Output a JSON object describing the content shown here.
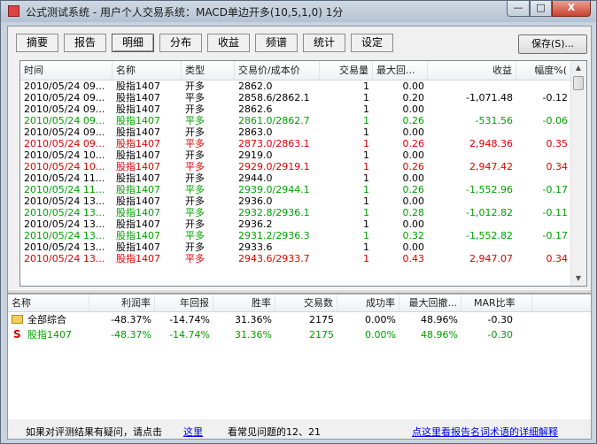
{
  "window": {
    "title": "公式测试系统 - 用户个人交易系统：MACD单边开多(10,5,1,0) 1分",
    "min_label": "—",
    "max_label": "□",
    "close_label": "X"
  },
  "tabs": [
    "摘要",
    "报告",
    "明细",
    "分布",
    "收益",
    "频谱",
    "统计",
    "设定"
  ],
  "active_tab": "明细",
  "save_button": "保存(S)...",
  "details_table": {
    "columns": [
      "时间",
      "名称",
      "类型",
      "交易价/成本价",
      "交易量",
      "最大回...",
      "收益",
      "幅度%("
    ],
    "rows": [
      {
        "time": "2010/05/24 09...",
        "name": "股指1407",
        "type": "开多",
        "price": "2862.0",
        "vol": "1",
        "dd": "0.00",
        "profit": "",
        "pct": "",
        "color": "black"
      },
      {
        "time": "2010/05/24 09...",
        "name": "股指1407",
        "type": "平多",
        "price": "2858.6/2862.1",
        "vol": "1",
        "dd": "0.20",
        "profit": "-1,071.48",
        "pct": "-0.12",
        "color": "black"
      },
      {
        "time": "2010/05/24 09...",
        "name": "股指1407",
        "type": "开多",
        "price": "2862.6",
        "vol": "1",
        "dd": "0.00",
        "profit": "",
        "pct": "",
        "color": "black"
      },
      {
        "time": "2010/05/24 09...",
        "name": "股指1407",
        "type": "平多",
        "price": "2861.0/2862.7",
        "vol": "1",
        "dd": "0.26",
        "profit": "-531.56",
        "pct": "-0.06",
        "color": "green"
      },
      {
        "time": "2010/05/24 09...",
        "name": "股指1407",
        "type": "开多",
        "price": "2863.0",
        "vol": "1",
        "dd": "0.00",
        "profit": "",
        "pct": "",
        "color": "black"
      },
      {
        "time": "2010/05/24 09...",
        "name": "股指1407",
        "type": "平多",
        "price": "2873.0/2863.1",
        "vol": "1",
        "dd": "0.26",
        "profit": "2,948.36",
        "pct": "0.35",
        "color": "red"
      },
      {
        "time": "2010/05/24 10...",
        "name": "股指1407",
        "type": "开多",
        "price": "2919.0",
        "vol": "1",
        "dd": "0.00",
        "profit": "",
        "pct": "",
        "color": "black"
      },
      {
        "time": "2010/05/24 10...",
        "name": "股指1407",
        "type": "平多",
        "price": "2929.0/2919.1",
        "vol": "1",
        "dd": "0.26",
        "profit": "2,947.42",
        "pct": "0.34",
        "color": "red"
      },
      {
        "time": "2010/05/24 11...",
        "name": "股指1407",
        "type": "开多",
        "price": "2944.0",
        "vol": "1",
        "dd": "0.00",
        "profit": "",
        "pct": "",
        "color": "black"
      },
      {
        "time": "2010/05/24 11...",
        "name": "股指1407",
        "type": "平多",
        "price": "2939.0/2944.1",
        "vol": "1",
        "dd": "0.26",
        "profit": "-1,552.96",
        "pct": "-0.17",
        "color": "green"
      },
      {
        "time": "2010/05/24 13...",
        "name": "股指1407",
        "type": "开多",
        "price": "2936.0",
        "vol": "1",
        "dd": "0.00",
        "profit": "",
        "pct": "",
        "color": "black"
      },
      {
        "time": "2010/05/24 13...",
        "name": "股指1407",
        "type": "平多",
        "price": "2932.8/2936.1",
        "vol": "1",
        "dd": "0.28",
        "profit": "-1,012.82",
        "pct": "-0.11",
        "color": "green"
      },
      {
        "time": "2010/05/24 13...",
        "name": "股指1407",
        "type": "开多",
        "price": "2936.2",
        "vol": "1",
        "dd": "0.00",
        "profit": "",
        "pct": "",
        "color": "black"
      },
      {
        "time": "2010/05/24 13...",
        "name": "股指1407",
        "type": "平多",
        "price": "2931.2/2936.3",
        "vol": "1",
        "dd": "0.32",
        "profit": "-1,552.82",
        "pct": "-0.17",
        "color": "green"
      },
      {
        "time": "2010/05/24 13...",
        "name": "股指1407",
        "type": "开多",
        "price": "2933.6",
        "vol": "1",
        "dd": "0.00",
        "profit": "",
        "pct": "",
        "color": "black"
      },
      {
        "time": "2010/05/24 13...",
        "name": "股指1407",
        "type": "平多",
        "price": "2943.6/2933.7",
        "vol": "1",
        "dd": "0.43",
        "profit": "2,947.07",
        "pct": "0.34",
        "color": "red"
      }
    ]
  },
  "summary_table": {
    "columns": [
      "名称",
      "利润率",
      "年回报",
      "胜率",
      "交易数",
      "成功率",
      "最大回撤...",
      "MAR比率"
    ],
    "rows": [
      {
        "icon": "folder-icon",
        "name": "全部综合",
        "profit_rate": "-48.37%",
        "annual": "-14.74%",
        "win": "31.36%",
        "trades": "2175",
        "success": "0.00%",
        "max_dd": "48.96%",
        "mar": "-0.30",
        "color": "black"
      },
      {
        "icon": "strategy-s-icon",
        "icon_glyph": "S",
        "name": "股指1407",
        "profit_rate": "-48.37%",
        "annual": "-14.74%",
        "win": "31.36%",
        "trades": "2175",
        "success": "0.00%",
        "max_dd": "48.96%",
        "mar": "-0.30",
        "color": "green"
      }
    ]
  },
  "status_bar": {
    "prefix": "如果对评测结果有疑问，请点击",
    "link": "这里",
    "suffix": "看常见问题的12、21",
    "right_link": "点这里看报告名词术语的详细解释"
  },
  "colors": {
    "profit_red": "#e00000",
    "loss_green": "#00a000",
    "link": "#0000ee"
  }
}
